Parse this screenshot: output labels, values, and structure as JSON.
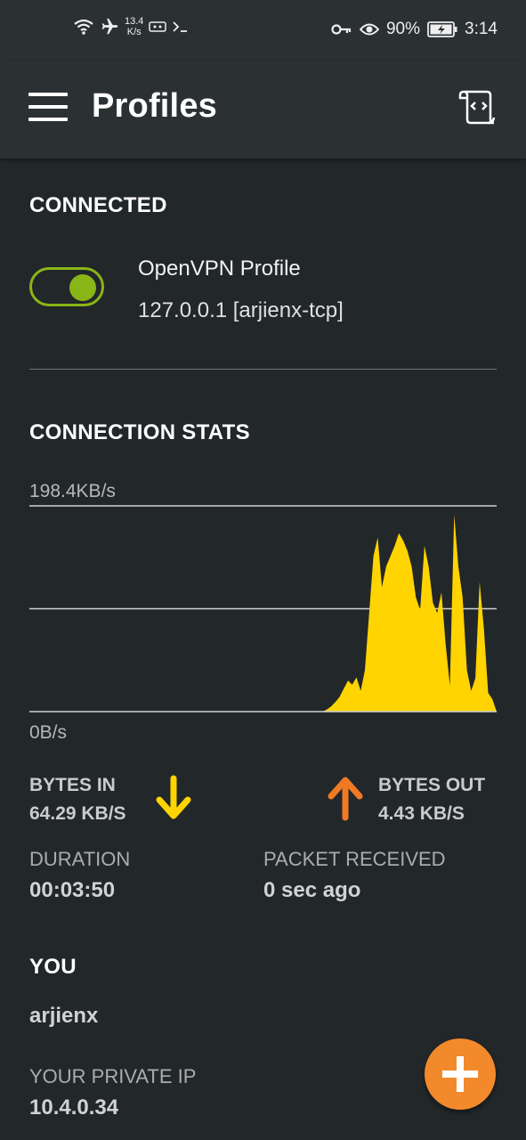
{
  "statusbar": {
    "net_speed_value": "13.4",
    "net_speed_unit": "K/s",
    "battery": "90%",
    "time": "3:14",
    "icons": [
      "wifi-icon",
      "airplane-icon",
      "vpn-indicator-icon",
      "terminal-icon",
      "key-icon",
      "eye-icon",
      "battery-icon"
    ]
  },
  "appbar": {
    "title": "Profiles"
  },
  "connected": {
    "section_title": "CONNECTED",
    "toggle_on": true,
    "profile_name": "OpenVPN Profile",
    "profile_detail": "127.0.0.1 [arjienx-tcp]"
  },
  "stats": {
    "section_title": "CONNECTION STATS",
    "max_label": "198.4KB/s",
    "min_label": "0B/s",
    "bytes_in_label": "BYTES IN",
    "bytes_in_value": "64.29 KB/S",
    "bytes_out_label": "BYTES OUT",
    "bytes_out_value": "4.43 KB/S",
    "duration_label": "DURATION",
    "duration_value": "00:03:50",
    "packet_label": "PACKET RECEIVED",
    "packet_value": "0 sec ago"
  },
  "you": {
    "section_title": "YOU",
    "username": "arjienx",
    "private_ip_label": "YOUR PRIVATE IP",
    "private_ip_value": "10.4.0.34"
  },
  "colors": {
    "accent_green": "#8ab517",
    "chart_yellow": "#ffd400",
    "down_arrow": "#ffd400",
    "up_arrow": "#f07a23",
    "fab": "#f28a2c"
  },
  "chart_data": {
    "type": "area",
    "ylim": [
      0,
      198.4
    ],
    "y_unit": "KB/s",
    "values": [
      0,
      0,
      0,
      0,
      0,
      0,
      0,
      0,
      0,
      0,
      0,
      0,
      0,
      0,
      0,
      0,
      0,
      0,
      0,
      0,
      0,
      0,
      0,
      0,
      0,
      0,
      0,
      0,
      0,
      0,
      0,
      0,
      0,
      0,
      0,
      0,
      0,
      0,
      0,
      0,
      0,
      0,
      0,
      0,
      0,
      0,
      0,
      0,
      0,
      0,
      0,
      0,
      0,
      0,
      0,
      0,
      0,
      0,
      0,
      0,
      0,
      0,
      0,
      0,
      0,
      0,
      0,
      0,
      0,
      0,
      2,
      5,
      9,
      14,
      22,
      30,
      26,
      33,
      20,
      40,
      95,
      150,
      168,
      120,
      140,
      150,
      160,
      172,
      165,
      155,
      140,
      110,
      98,
      160,
      140,
      105,
      95,
      115,
      65,
      25,
      190,
      140,
      110,
      40,
      20,
      32,
      125,
      80,
      18,
      12,
      0
    ]
  }
}
